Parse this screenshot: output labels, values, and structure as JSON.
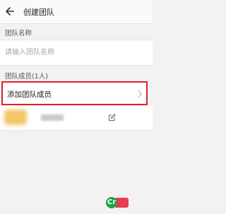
{
  "header": {
    "title": "创建团队",
    "back_icon": "arrow-left-icon"
  },
  "team_name": {
    "label": "团队名称",
    "placeholder": "请输入团队名称",
    "value": ""
  },
  "members": {
    "label": "团队成员(1人)",
    "add_label": "添加团队成员",
    "add_icon": "chevron-right-icon",
    "edit_icon": "edit-icon"
  },
  "colors": {
    "highlight_border": "#e2222a",
    "background": "#f2f2f2"
  },
  "watermark": {
    "logo": "Cr"
  }
}
